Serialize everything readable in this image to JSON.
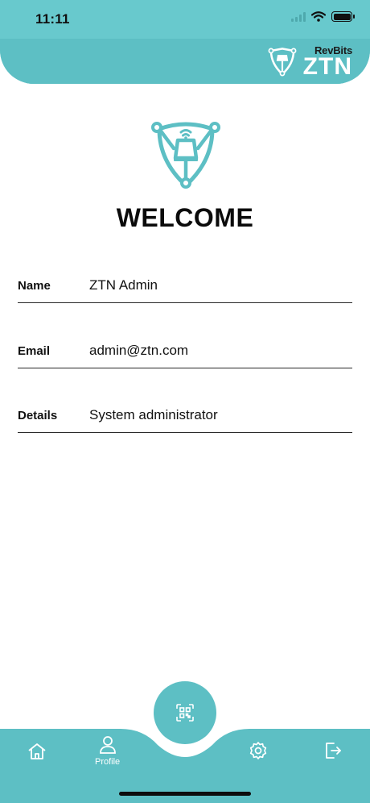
{
  "status_bar": {
    "time": "11:11"
  },
  "brand": {
    "small_label": "RevBits",
    "big_label": "ZTN"
  },
  "welcome_title": "WELCOME",
  "fields": [
    {
      "label": "Name",
      "value": "ZTN Admin"
    },
    {
      "label": "Email",
      "value": "admin@ztn.com"
    },
    {
      "label": "Details",
      "value": "System administrator"
    }
  ],
  "tabbar": {
    "active_tab_label": "Profile",
    "icons": [
      "home-icon",
      "profile-icon",
      "qr-scan-icon",
      "settings-icon",
      "logout-icon"
    ]
  },
  "colors": {
    "accent": "#5dbfc4",
    "header_light": "#68c9cd",
    "text": "#111111"
  }
}
